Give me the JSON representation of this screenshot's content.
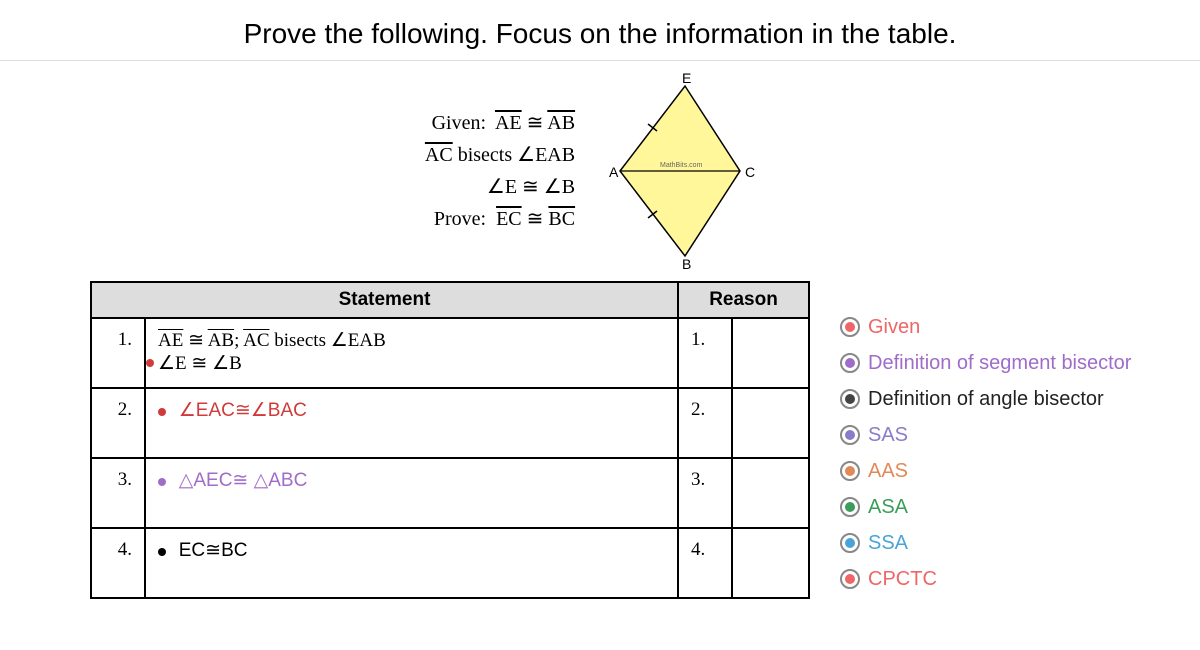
{
  "title": "Prove the following. Focus on the information in the table.",
  "given": {
    "label": "Given:",
    "line1a": "AE",
    "line1b": "AB",
    "line2a": "AC",
    "line2b": " bisects ",
    "line2c": "EAB",
    "line3a": "E",
    "line3b": "B",
    "prove_label": "Prove:",
    "line4a": "EC",
    "line4b": "BC"
  },
  "figure": {
    "labels": {
      "A": "A",
      "B": "B",
      "C": "C",
      "E": "E",
      "credit": "MathBits.com"
    }
  },
  "table": {
    "headers": {
      "statement": "Statement",
      "reason": "Reason"
    },
    "rows": [
      {
        "n": "1.",
        "stmt_pre": "AE",
        "stmt_mid": "AB",
        "stmt_sep": "; ",
        "stmt_ac": "AC",
        "stmt_bisects": " bisects ",
        "stmt_ang": "EAB",
        "stmt_line2_pre": "E",
        "stmt_line2_post": "B",
        "dot": "#d13a3a",
        "color": ""
      },
      {
        "n": "2.",
        "stmt": "∠EAC≅∠BAC",
        "dot": "#d13a3a",
        "color": "txt-red"
      },
      {
        "n": "3.",
        "stmt": "△AEC≅ △ABC",
        "dot": "#a06cc9",
        "color": "txt-purple"
      },
      {
        "n": "4.",
        "stmt": "EC≅BC",
        "dot": "#000",
        "color": "txt-black"
      }
    ]
  },
  "legend": [
    {
      "label": "Given",
      "color": "#e66",
      "txt": "#e66"
    },
    {
      "label": "Definition of segment bisector",
      "color": "#a06cc9",
      "txt": "#a06cc9"
    },
    {
      "label": "Definition of angle bisector",
      "color": "#444",
      "txt": "#222"
    },
    {
      "label": "SAS",
      "color": "#8a7cc9",
      "txt": "#8a7cc9"
    },
    {
      "label": "AAS",
      "color": "#e08a5a",
      "txt": "#e08a5a"
    },
    {
      "label": "ASA",
      "color": "#3a9d5a",
      "txt": "#3a9d5a"
    },
    {
      "label": "SSA",
      "color": "#4aa3d8",
      "txt": "#4aa3d8"
    },
    {
      "label": "CPCTC",
      "color": "#e66",
      "txt": "#e66"
    }
  ]
}
